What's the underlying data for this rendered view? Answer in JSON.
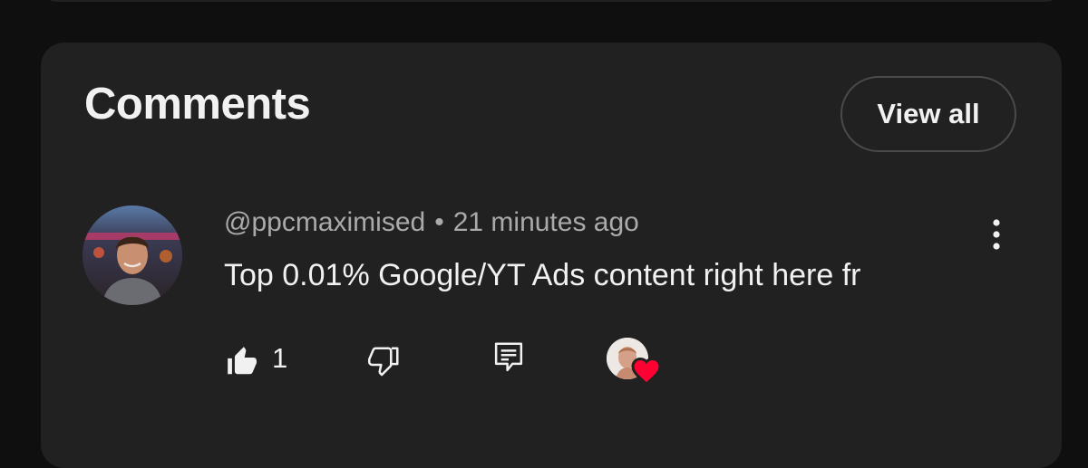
{
  "comments_section": {
    "title": "Comments",
    "view_all_label": "View all"
  },
  "comment": {
    "author": "@ppcmaximised",
    "separator": "•",
    "time": "21 minutes ago",
    "text": "Top 0.01% Google/YT Ads content right here fr",
    "like_count": "1"
  },
  "icons": {
    "more": "more-vert-icon",
    "like": "thumb-up-icon",
    "dislike": "thumb-down-icon",
    "reply": "reply-icon",
    "creator_heart": "heart-icon"
  },
  "colors": {
    "background": "#0f0f0f",
    "card": "#212121",
    "primary_text": "#f1f1f1",
    "secondary_text": "#aaaaaa",
    "heart": "#ff0033"
  }
}
